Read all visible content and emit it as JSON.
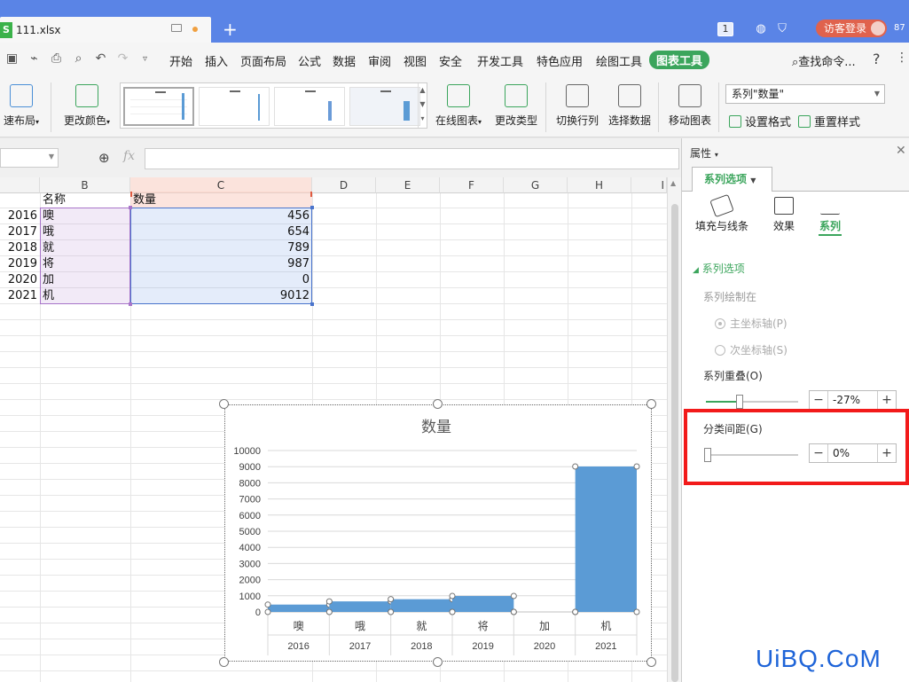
{
  "titlebar": {
    "file_name": "111.xlsx",
    "app_logo": "S",
    "badge": "1",
    "login_label": "访客登录",
    "trailing_text": "87"
  },
  "menu": {
    "items": [
      "开始",
      "插入",
      "页面布局",
      "公式",
      "数据",
      "审阅",
      "视图",
      "安全",
      "开发工具",
      "特色应用",
      "绘图工具",
      "图表工具"
    ],
    "active": "图表工具",
    "find_label": "查找命令...",
    "help": "?"
  },
  "ribbon": {
    "quick_layout": "速布局",
    "change_color": "更改颜色",
    "online_chart": "在线图表",
    "change_type": "更改类型",
    "switch_row_col": "切换行列",
    "select_data": "选择数据",
    "move_chart": "移动图表",
    "series_select": "系列\"数量\"",
    "set_format": "设置格式",
    "reset_style": "重置样式"
  },
  "formula": {
    "fx": "fx"
  },
  "sheet": {
    "columns": [
      "B",
      "C",
      "D",
      "E",
      "F",
      "G",
      "H",
      "I"
    ],
    "header_name": "名称",
    "header_qty": "数量",
    "rows": [
      {
        "year": "2016",
        "name": "噢",
        "qty": "456"
      },
      {
        "year": "2017",
        "name": "哦",
        "qty": "654"
      },
      {
        "year": "2018",
        "name": "就",
        "qty": "789"
      },
      {
        "year": "2019",
        "name": "将",
        "qty": "987"
      },
      {
        "year": "2020",
        "name": "加",
        "qty": "0"
      },
      {
        "year": "2021",
        "name": "机",
        "qty": "9012"
      }
    ]
  },
  "chart_data": {
    "type": "bar",
    "title": "数量",
    "categories": [
      "噢",
      "哦",
      "就",
      "将",
      "加",
      "机"
    ],
    "category_groups": [
      "2016",
      "2017",
      "2018",
      "2019",
      "2020",
      "2021"
    ],
    "values": [
      456,
      654,
      789,
      987,
      0,
      9012
    ],
    "ylim": [
      0,
      10000
    ],
    "yticks": [
      0,
      1000,
      2000,
      3000,
      4000,
      5000,
      6000,
      7000,
      8000,
      9000,
      10000
    ],
    "color": "#5b9bd5",
    "grid": true,
    "legend": "none",
    "gap_width_percent": 0
  },
  "panel": {
    "title": "属性",
    "tab": "系列选项",
    "sub_tabs": [
      "填充与线条",
      "效果",
      "系列"
    ],
    "active_sub_tab": "系列",
    "section_title": "系列选项",
    "plot_on_label": "系列绘制在",
    "primary_axis": "主坐标轴(P)",
    "secondary_axis": "次坐标轴(S)",
    "overlap_label": "系列重叠(O)",
    "overlap_value": "-27%",
    "overlap_fraction": 0.37,
    "gap_label": "分类间距(G)",
    "gap_value": "0%",
    "gap_fraction": 0.0,
    "minus": "−",
    "plus": "+"
  },
  "colors": {
    "accent_green": "#3ba55c",
    "title_blue": "#5a84e6",
    "highlight_red": "#f21a1a",
    "bar_blue": "#5b9bd5"
  },
  "watermark": "UiBQ.CoM"
}
